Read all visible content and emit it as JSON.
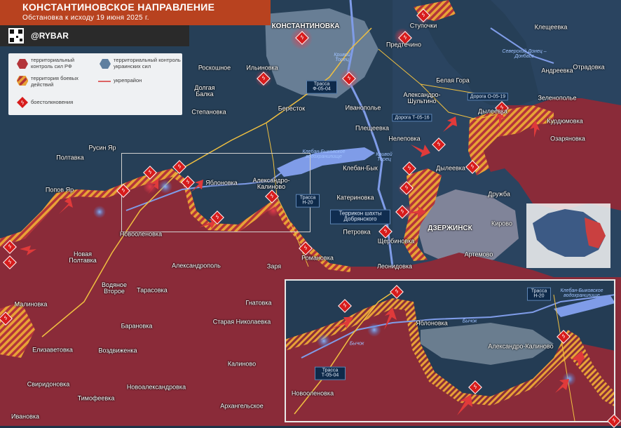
{
  "header": {
    "title": "КОНСТАНТИНОВСКОЕ НАПРАВЛЕНИЕ",
    "subtitle": "Обстановка к исходу 19 июня 2025 г."
  },
  "brand": {
    "name": "@RYBAR"
  },
  "legend": {
    "items": [
      {
        "key": "ru",
        "label": "территориальный контроль сил РФ",
        "color": "#b3343a"
      },
      {
        "key": "ua",
        "label": "территориальный контроль украинских сил",
        "color": "#5f7f9f"
      },
      {
        "key": "combat",
        "label": "территория боевых действий",
        "color": "#e8a236"
      },
      {
        "key": "fort",
        "label": "укрепрайон",
        "color": "#d63535"
      },
      {
        "key": "clash",
        "label": "боестолкновения",
        "color": "#d71c1c"
      }
    ]
  },
  "settlements": [
    {
      "id": "konstantinovka",
      "name": "КОНСТАНТИНОВКА",
      "big": true
    },
    {
      "id": "stupochki",
      "name": "Ступочки"
    },
    {
      "id": "kleshcheevka",
      "name": "Клещеевка"
    },
    {
      "id": "predtechino",
      "name": "Предтечино"
    },
    {
      "id": "roskoshnoe",
      "name": "Роскошное"
    },
    {
      "id": "ilinovka",
      "name": "Ильиновка"
    },
    {
      "id": "andreevka",
      "name": "Андреевка"
    },
    {
      "id": "otradovka",
      "name": "Отрадовка"
    },
    {
      "id": "dolgaya-balka",
      "name": "Долгая Балка"
    },
    {
      "id": "belaya-gora",
      "name": "Белая Гора"
    },
    {
      "id": "aleksandro-shultino",
      "name": "Александро-Шультино"
    },
    {
      "id": "zelenopole",
      "name": "Зеленополье"
    },
    {
      "id": "berestok",
      "name": "Бересток"
    },
    {
      "id": "ivanopole",
      "name": "Иванополье"
    },
    {
      "id": "dyleevka-n",
      "name": "Дылеевка"
    },
    {
      "id": "kurdyumovka",
      "name": "Курдюмовка"
    },
    {
      "id": "stepanovka",
      "name": "Степановка"
    },
    {
      "id": "pleshcheevka",
      "name": "Плещеевка"
    },
    {
      "id": "ozaryanovka",
      "name": "Озаряновка"
    },
    {
      "id": "neleprovka",
      "name": "Нелеповка"
    },
    {
      "id": "rusin-yar",
      "name": "Русин Яр"
    },
    {
      "id": "poltavka",
      "name": "Полтавка"
    },
    {
      "id": "dyleevka-s",
      "name": "Дылеевка"
    },
    {
      "id": "kleban-byk",
      "name": "Клебан-Бык"
    },
    {
      "id": "yablonovka",
      "name": "Яблоновка"
    },
    {
      "id": "aleksandro-kalinovo",
      "name": "Александро-Калиново"
    },
    {
      "id": "popov-yar",
      "name": "Попов Яр"
    },
    {
      "id": "druzhba",
      "name": "Дружба"
    },
    {
      "id": "katerinovka",
      "name": "Катериновка"
    },
    {
      "id": "dzerzhinsk",
      "name": "ДЗЕРЖИНСК",
      "big": true
    },
    {
      "id": "kirovo",
      "name": "Кирово"
    },
    {
      "id": "novoolenovka",
      "name": "Новооленовка"
    },
    {
      "id": "petrovka",
      "name": "Петровка"
    },
    {
      "id": "shcherbinovka",
      "name": "Щербиновка"
    },
    {
      "id": "novaya-poltavka",
      "name": "Новая Полтавка"
    },
    {
      "id": "artemovo",
      "name": "Артемово"
    },
    {
      "id": "romanovka",
      "name": "Романовка"
    },
    {
      "id": "aleksandropol",
      "name": "Александрополь"
    },
    {
      "id": "leonidovka",
      "name": "Леонидовка"
    },
    {
      "id": "zarya",
      "name": "Заря"
    },
    {
      "id": "vodyanoe-vtoroe",
      "name": "Водяное Второе"
    },
    {
      "id": "tarasovka",
      "name": "Тарасовка"
    },
    {
      "id": "malinovka",
      "name": "Малиновка"
    },
    {
      "id": "gnatovka",
      "name": "Гнатовка"
    },
    {
      "id": "staraya-nikolaevka",
      "name": "Старая Николаевка"
    },
    {
      "id": "baranovka",
      "name": "Барановка"
    },
    {
      "id": "elizavetovka",
      "name": "Елизаветовка"
    },
    {
      "id": "vozdvizhenka",
      "name": "Воздвиженка"
    },
    {
      "id": "kalinovo",
      "name": "Калиново"
    },
    {
      "id": "svirodonovka",
      "name": "Свиридоновка"
    },
    {
      "id": "novoaleksandrovka",
      "name": "Новоалександровка"
    },
    {
      "id": "timofeevka",
      "name": "Тимофеевка"
    },
    {
      "id": "arkhangelskoe",
      "name": "Архангельское"
    },
    {
      "id": "ivanovka",
      "name": "Ивановка"
    }
  ],
  "inset_settlements": [
    {
      "id": "inset-yablonovka",
      "name": "Яблоновка"
    },
    {
      "id": "inset-aleksandro-kalinovo",
      "name": "Александро-Калиново"
    },
    {
      "id": "inset-novoolenovka",
      "name": "Новооленовка"
    }
  ],
  "water_labels": [
    {
      "id": "krivoy-torets-n",
      "name": "Кривой Торец"
    },
    {
      "id": "severskiy-donets",
      "name": "Северский Донец – Донбасс"
    },
    {
      "id": "kleban-byk-reservoir",
      "name": "Клебан-Быковское водохранилище"
    },
    {
      "id": "krivoy-torets-s",
      "name": "Кривой Торец"
    },
    {
      "id": "inset-bychok",
      "name": "Бычок"
    },
    {
      "id": "inset-bychok-2",
      "name": "Бычок"
    },
    {
      "id": "inset-reservoir",
      "name": "Клебан-Быковское водохранилище"
    }
  ],
  "roads": [
    {
      "id": "f-05-04",
      "label": "Трасса Ф-05-04"
    },
    {
      "id": "o-05-19",
      "label": "Дорога О-05-19"
    },
    {
      "id": "t-05-16",
      "label": "Дорога Т-05-16"
    },
    {
      "id": "n-20",
      "label": "Трасса Н-20"
    },
    {
      "id": "inset-n-20",
      "label": "Трасса Н-20"
    },
    {
      "id": "inset-f-05-04",
      "label": "Трасса Т-05-04"
    }
  ],
  "landmarks": [
    {
      "id": "terrikon",
      "label": "Террикон шахты Добрянского"
    }
  ],
  "colors": {
    "ru_control": "#b3343a",
    "ua_control": "#253d55",
    "combat_zone": "#e8a236",
    "urban": "#9eb2c8",
    "water": "#7f9ce8",
    "road": "#f0c040"
  }
}
